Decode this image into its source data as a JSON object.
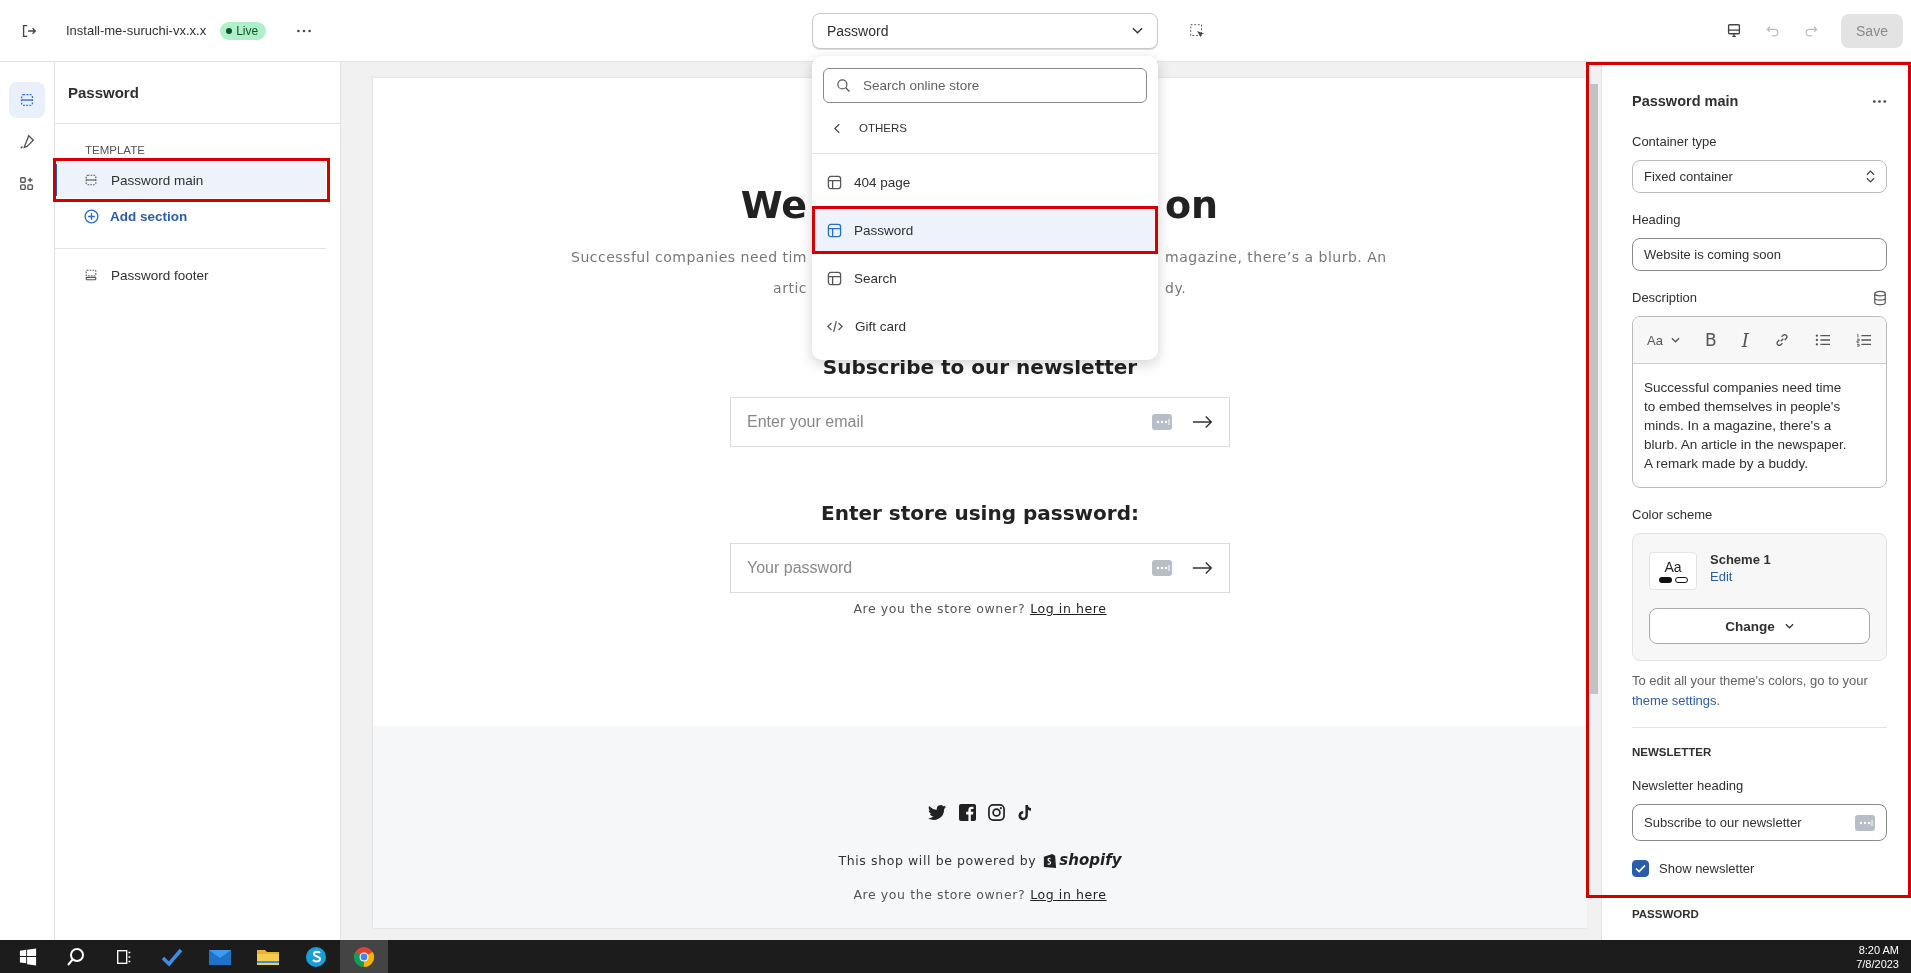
{
  "topbar": {
    "store_name": "Install-me-suruchi-vx.x.x",
    "status": "Live",
    "template_select": "Password",
    "save": "Save",
    "save_disabled": true
  },
  "rail": [
    {
      "kind": "sections",
      "selected": true
    },
    {
      "kind": "theme",
      "selected": false
    },
    {
      "kind": "apps",
      "selected": false
    }
  ],
  "sidebar": {
    "title": "Password",
    "group_label": "TEMPLATE",
    "sections": [
      {
        "label": "Password main",
        "selected": true,
        "highlighted": true
      }
    ],
    "add_section": "Add section",
    "footer_sections": [
      {
        "label": "Password footer",
        "selected": false
      }
    ]
  },
  "dropdown": {
    "search_placeholder": "Search online store",
    "group": "OTHERS",
    "items": [
      {
        "label": "404 page",
        "kind": "template",
        "selected": false,
        "highlighted": false
      },
      {
        "label": "Password",
        "kind": "template",
        "selected": true,
        "highlighted": true
      },
      {
        "label": "Search",
        "kind": "template",
        "selected": false,
        "highlighted": false
      },
      {
        "label": "Gift card",
        "kind": "code",
        "selected": false,
        "highlighted": false
      }
    ]
  },
  "preview": {
    "heading_parts": [
      "We",
      "on"
    ],
    "description_lines": [
      [
        "Successful companies need tim",
        "magazine, there’s a blurb. An"
      ],
      [
        "artic",
        "dy."
      ]
    ],
    "newsletter_heading": "Subscribe to our newsletter",
    "email_placeholder": "Enter your email",
    "password_heading": "Enter store using password:",
    "password_placeholder": "Your password",
    "owner_text": "Are you the store owner?",
    "owner_link": "Log in here",
    "footer": {
      "socials": [
        {
          "kind": "twitter"
        },
        {
          "kind": "facebook"
        },
        {
          "kind": "instagram"
        },
        {
          "kind": "tiktok"
        }
      ],
      "powered_by": "This shop will be powered by",
      "brand": "shopify",
      "owner_text": "Are you the store owner?",
      "owner_link": "Log in here"
    }
  },
  "settings": {
    "highlighted": true,
    "title": "Password main",
    "container_label": "Container type",
    "container_value": "Fixed container",
    "heading_label": "Heading",
    "heading_value": "Website is coming soon",
    "description_label": "Description",
    "toolbar": [
      {
        "kind": "style",
        "label": "Aa"
      },
      {
        "kind": "bold",
        "label": "B"
      },
      {
        "kind": "italic",
        "label": "I"
      },
      {
        "kind": "link"
      },
      {
        "kind": "bullets"
      },
      {
        "kind": "numbers"
      }
    ],
    "description_value": "Successful companies need time to embed themselves in people's minds. In a magazine, there's a blurb. An article in the newspaper. A remark made by a buddy.",
    "color_label": "Color scheme",
    "scheme_sample": "Aa",
    "scheme_name": "Scheme 1",
    "scheme_edit": "Edit",
    "change": "Change",
    "hint": "To edit all your theme's colors, go to your",
    "hint_link": "theme settings",
    "hint_end": ".",
    "newsletter_section": "NEWSLETTER",
    "newsletter_heading_label": "Newsletter heading",
    "newsletter_heading_value": "Subscribe to our newsletter",
    "show_newsletter": {
      "label": "Show newsletter",
      "checked": true
    },
    "password_section": "PASSWORD"
  },
  "taskbar": {
    "apps": [
      {
        "kind": "windows",
        "selected": false
      },
      {
        "kind": "search",
        "selected": false
      },
      {
        "kind": "taskview",
        "selected": false
      },
      {
        "kind": "todo",
        "selected": false
      },
      {
        "kind": "mail",
        "selected": false
      },
      {
        "kind": "folder",
        "selected": false
      },
      {
        "kind": "skype",
        "selected": false
      },
      {
        "kind": "chrome",
        "selected": true
      }
    ],
    "time": "8:20 AM",
    "date": "7/8/2023"
  }
}
